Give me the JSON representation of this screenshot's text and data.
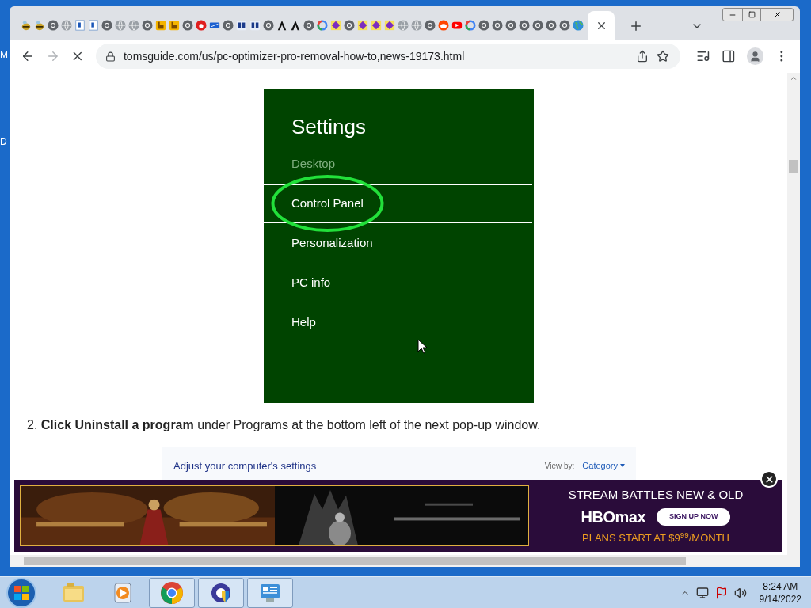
{
  "desktop": {
    "icon_labels": [
      "M",
      "D"
    ]
  },
  "browser": {
    "tabs": [
      {
        "kind": "bee",
        "selected": false
      },
      {
        "kind": "bee",
        "selected": false
      },
      {
        "kind": "chrome",
        "selected": false
      },
      {
        "kind": "globe",
        "selected": false
      },
      {
        "kind": "doc",
        "selected": false
      },
      {
        "kind": "doc",
        "selected": false
      },
      {
        "kind": "chrome",
        "selected": false
      },
      {
        "kind": "globe",
        "selected": false
      },
      {
        "kind": "globe",
        "selected": false
      },
      {
        "kind": "chrome",
        "selected": false
      },
      {
        "kind": "orange",
        "selected": false
      },
      {
        "kind": "orange",
        "selected": false
      },
      {
        "kind": "chrome",
        "selected": false
      },
      {
        "kind": "red",
        "selected": false
      },
      {
        "kind": "blue",
        "selected": false
      },
      {
        "kind": "chrome",
        "selected": false
      },
      {
        "kind": "ks",
        "selected": false
      },
      {
        "kind": "ks",
        "selected": false
      },
      {
        "kind": "chrome",
        "selected": false
      },
      {
        "kind": "black",
        "selected": false
      },
      {
        "kind": "black",
        "selected": false
      },
      {
        "kind": "chrome",
        "selected": false
      },
      {
        "kind": "g",
        "selected": false
      },
      {
        "kind": "diamond",
        "selected": false
      },
      {
        "kind": "chrome",
        "selected": false
      },
      {
        "kind": "diamond",
        "selected": false
      },
      {
        "kind": "diamond",
        "selected": false
      },
      {
        "kind": "diamond",
        "selected": false
      },
      {
        "kind": "globe",
        "selected": false
      },
      {
        "kind": "globe",
        "selected": false
      },
      {
        "kind": "chrome",
        "selected": false
      },
      {
        "kind": "reddit",
        "selected": false
      },
      {
        "kind": "youtube",
        "selected": false
      },
      {
        "kind": "g",
        "selected": false
      },
      {
        "kind": "chrome",
        "selected": false
      },
      {
        "kind": "chrome",
        "selected": false
      },
      {
        "kind": "chrome",
        "selected": false
      },
      {
        "kind": "chrome",
        "selected": false
      },
      {
        "kind": "chrome",
        "selected": false
      },
      {
        "kind": "chrome",
        "selected": false
      },
      {
        "kind": "chrome",
        "selected": false
      },
      {
        "kind": "earth",
        "selected": false
      },
      {
        "selected": true
      }
    ],
    "url": "tomsguide.com/us/pc-optimizer-pro-removal-how-to,news-19173.html",
    "loading": true
  },
  "article": {
    "settings_image": {
      "title": "Settings",
      "items": [
        {
          "label": "Desktop",
          "dimmed": true,
          "selected": false,
          "circled": false
        },
        {
          "label": "Control Panel",
          "dimmed": false,
          "selected": true,
          "circled": true
        },
        {
          "label": "Personalization",
          "dimmed": false,
          "selected": false,
          "circled": false
        },
        {
          "label": "PC info",
          "dimmed": false,
          "selected": false,
          "circled": false
        },
        {
          "label": "Help",
          "dimmed": false,
          "selected": false,
          "circled": false
        }
      ]
    },
    "step": "2. **Click Uninstall a program** under Programs at the bottom left of the next pop-up window.",
    "control_panel_image": {
      "heading": "Adjust your computer's settings",
      "view_by_label": "View by:",
      "view_by_value": "Category"
    }
  },
  "ad": {
    "headline": "STREAM BATTLES NEW & OLD",
    "brand": "HBOmax",
    "button": "SIGN UP NOW",
    "price": "PLANS START AT $9$^{99}$/MONTH"
  },
  "taskbar": {
    "apps": [
      {
        "kind": "folder",
        "active": false
      },
      {
        "kind": "media",
        "active": false
      },
      {
        "kind": "chrome",
        "active": true
      },
      {
        "kind": "shield",
        "active": true
      },
      {
        "kind": "panel",
        "active": true
      }
    ],
    "time": "8:24 AM",
    "date": "9/14/2022"
  }
}
